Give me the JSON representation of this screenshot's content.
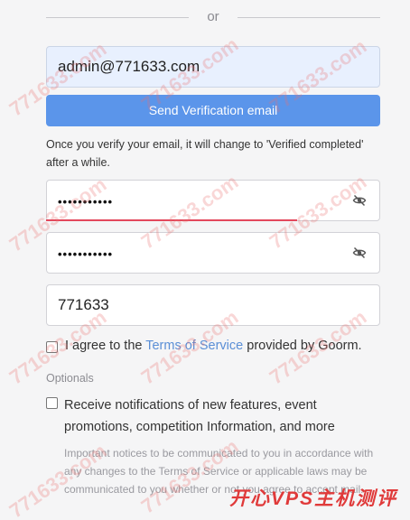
{
  "divider": {
    "text": "or"
  },
  "email": {
    "value": "admin@771633.com"
  },
  "send_button": {
    "label": "Send Verification email"
  },
  "hint": {
    "text": "Once you verify your email, it will change to 'Verified completed' after a while."
  },
  "password": {
    "masked": "•••••••••••"
  },
  "password_confirm": {
    "masked": "•••••••••••"
  },
  "code": {
    "value": "771633"
  },
  "terms": {
    "prefix": "I agree to the",
    "link": "Terms of Service",
    "suffix": "provided by Goorm."
  },
  "optionals": {
    "title": "Optionals"
  },
  "notify": {
    "label": "Receive notifications of new features, event promotions, competition Information, and more",
    "description": "Important notices to be communicated to you in accordance with any changes to the Terms of Service or applicable laws may be communicated to you whether or not you agree to accept mail."
  },
  "watermark": {
    "text": "771633.com",
    "logo": "开心VPS主机测评"
  },
  "colors": {
    "accent": "#5b95ea",
    "link": "#5b8fd6",
    "focus": "#e3485c",
    "autofill": "#e8f0fe"
  },
  "icons": {
    "visibility_toggle": "eye-off-icon"
  }
}
